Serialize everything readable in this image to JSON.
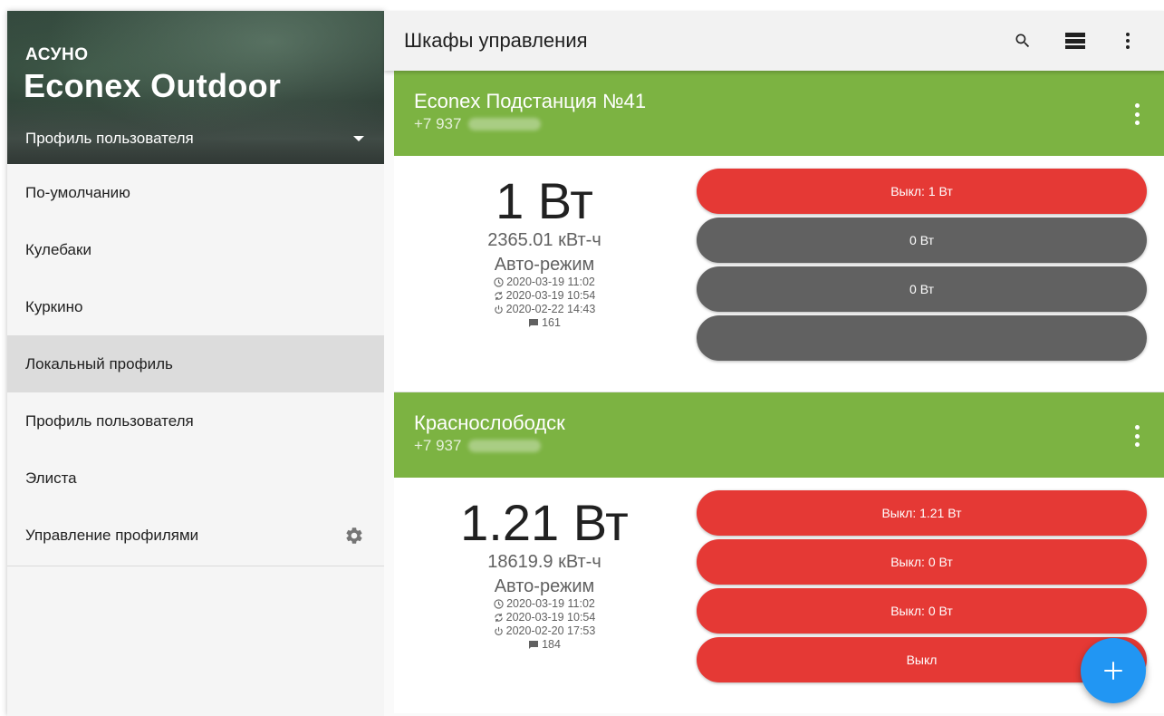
{
  "drawer": {
    "subtitle": "АСУНО",
    "title": "Econex Outdoor",
    "profile_label": "Профиль пользователя",
    "items": [
      {
        "label": "По-умолчанию"
      },
      {
        "label": "Кулебаки"
      },
      {
        "label": "Куркино"
      },
      {
        "label": "Локальный профиль"
      },
      {
        "label": "Профиль пользователя"
      },
      {
        "label": "Элиста"
      },
      {
        "label": "Управление профилями"
      }
    ]
  },
  "toolbar": {
    "title": "Шкафы управления",
    "icons": [
      "search-icon",
      "view-list-icon",
      "more-vert-icon"
    ]
  },
  "colors": {
    "header_green": "#7cb342",
    "button_red": "#e53935",
    "button_gray": "#616161",
    "fab_blue": "#2196f3"
  },
  "cards": [
    {
      "name": "Econex Подстанция №41",
      "phone": "+7 937",
      "power": "1 Вт",
      "energy": "2365.01 кВт-ч",
      "mode": "Авто-режим",
      "time_updated": "2020-03-19 11:02",
      "time_synced": "2020-03-19 10:54",
      "time_power": "2020-02-22 14:43",
      "messages": "161",
      "buttons": [
        {
          "label": "Выкл: 1 Вт"
        },
        {
          "label": "0 Вт"
        },
        {
          "label": "0 Вт"
        },
        {
          "label": ""
        }
      ]
    },
    {
      "name": "Краснослободск",
      "phone": "+7 937",
      "power": "1.21 Вт",
      "energy": "18619.9 кВт-ч",
      "mode": "Авто-режим",
      "time_updated": "2020-03-19 11:02",
      "time_synced": "2020-03-19 10:54",
      "time_power": "2020-02-20 17:53",
      "messages": "184",
      "buttons": [
        {
          "label": "Выкл: 1.21 Вт"
        },
        {
          "label": "Выкл: 0 Вт"
        },
        {
          "label": "Выкл: 0 Вт"
        },
        {
          "label": "Выкл"
        }
      ]
    }
  ]
}
